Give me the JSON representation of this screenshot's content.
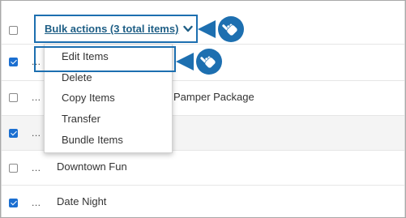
{
  "bulk_actions": {
    "label": "Bulk actions (3 total items)",
    "chevron_icon": "chevron-down-icon"
  },
  "dropdown": {
    "items": [
      {
        "label": "Edit Items"
      },
      {
        "label": "Delete"
      },
      {
        "label": "Copy Items"
      },
      {
        "label": "Transfer"
      },
      {
        "label": "Bundle Items"
      }
    ]
  },
  "table": {
    "rows": [
      {
        "checked": false,
        "name": ""
      },
      {
        "checked": true,
        "name": ""
      },
      {
        "checked": false,
        "name": "Pamper Package"
      },
      {
        "checked": true,
        "name": ""
      },
      {
        "checked": false,
        "name": "Downtown Fun"
      },
      {
        "checked": true,
        "name": "Date Night"
      }
    ],
    "row_menu_label": "..."
  },
  "annotations": {
    "pointer_icon": "hand-pointer-badge-icon",
    "color": "#1d6fb0"
  }
}
